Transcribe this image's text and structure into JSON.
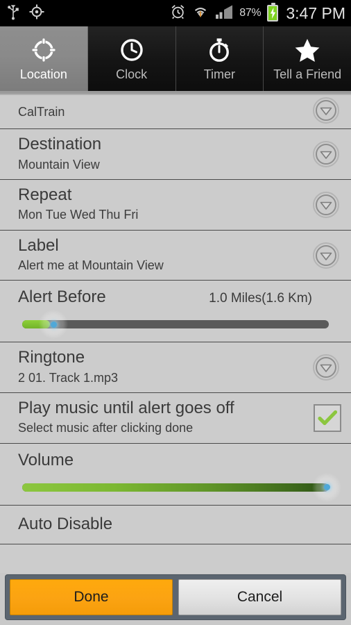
{
  "statusbar": {
    "icons_left": [
      "usb-icon",
      "gps-icon"
    ],
    "icons_right": [
      "alarm-icon",
      "wifi-icon",
      "signal-icon"
    ],
    "battery_percent": "87%",
    "battery_state": "charging",
    "time": "3:47 PM"
  },
  "tabs": [
    {
      "label": "Location",
      "icon": "crosshair-icon",
      "active": true
    },
    {
      "label": "Clock",
      "icon": "clock-icon",
      "active": false
    },
    {
      "label": "Timer",
      "icon": "stopwatch-icon",
      "active": false
    },
    {
      "label": "Tell a Friend",
      "icon": "star-icon",
      "active": false
    }
  ],
  "list": {
    "partial_top_row": {
      "subtitle": "CalTrain"
    },
    "rows": [
      {
        "title": "Destination",
        "subtitle": "Mountain View",
        "control": "chevron-down-icon"
      },
      {
        "title": "Repeat",
        "subtitle": "Mon Tue Wed Thu Fri",
        "control": "chevron-down-icon"
      },
      {
        "title": "Label",
        "subtitle": "Alert me at Mountain View",
        "control": "chevron-down-icon"
      }
    ],
    "alert_before": {
      "title": "Alert Before",
      "value": "1.0 Miles(1.6 Km)",
      "slider_percent": 5
    },
    "ringtone": {
      "title": "Ringtone",
      "subtitle": "2 01. Track 1.mp3",
      "control": "chevron-down-icon"
    },
    "play_music": {
      "title": "Play music until alert goes off",
      "subtitle": "Select music after clicking done",
      "checked": true,
      "control": "checkbox-checked-icon"
    },
    "volume": {
      "title": "Volume",
      "slider_percent": 100
    },
    "partial_bottom_row": {
      "title": "Auto Disable"
    }
  },
  "bottom_bar": {
    "done_label": "Done",
    "cancel_label": "Cancel"
  },
  "colors": {
    "accent_orange": "#FBA312",
    "accent_green": "#8CC63F",
    "list_bg": "#CCCCCC",
    "tab_active": "#8A8A8A",
    "bottom_bar": "#5B6570"
  }
}
